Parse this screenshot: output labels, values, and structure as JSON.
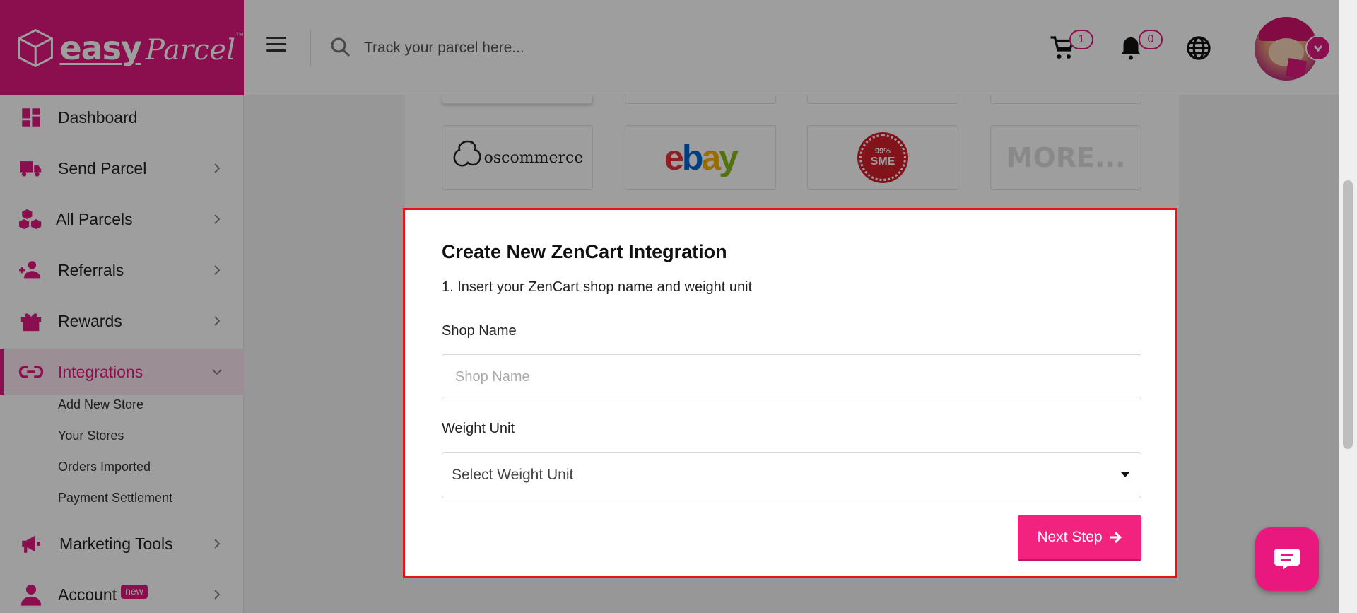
{
  "brand": {
    "name_bold": "easy",
    "name_script": "Parcel",
    "trademark": "™",
    "color": "#e0177f"
  },
  "header": {
    "search_placeholder": "Track your parcel here...",
    "cart_count": "1",
    "notification_count": "0",
    "icons": [
      "menu-icon",
      "search-icon",
      "cart-icon",
      "bell-icon",
      "globe-icon",
      "avatar",
      "chevron-down-icon"
    ]
  },
  "sidebar": {
    "items": [
      {
        "label": "Dashboard",
        "icon": "dashboard-icon"
      },
      {
        "label": "Send Parcel",
        "icon": "truck-icon"
      },
      {
        "label": "All Parcels",
        "icon": "boxes-icon"
      },
      {
        "label": "Referrals",
        "icon": "add-user-icon"
      },
      {
        "label": "Rewards",
        "icon": "gift-icon"
      },
      {
        "label": "Integrations",
        "icon": "link-icon"
      },
      {
        "label": "Marketing Tools",
        "icon": "megaphone-icon"
      },
      {
        "label": "Account",
        "icon": "user-icon",
        "badge": "new"
      }
    ],
    "integrations_sub": [
      "Add New Store",
      "Your Stores",
      "Orders Imported",
      "Payment Settlement"
    ]
  },
  "platforms": {
    "oscommerce": "oscommerce",
    "ebay": [
      "e",
      "b",
      "a",
      "y"
    ],
    "sme_seal": {
      "top": "99%",
      "main": "SME"
    },
    "more": "MORE..."
  },
  "modal": {
    "title": "Create New ZenCart Integration",
    "step": "1. Insert your ZenCart shop name and weight unit",
    "shop_name_label": "Shop Name",
    "shop_name_placeholder": "Shop Name",
    "weight_unit_label": "Weight Unit",
    "weight_unit_value": "Select Weight Unit",
    "next_button": "Next Step",
    "border_color": "#e8131b",
    "button_color": "#f2237f"
  }
}
